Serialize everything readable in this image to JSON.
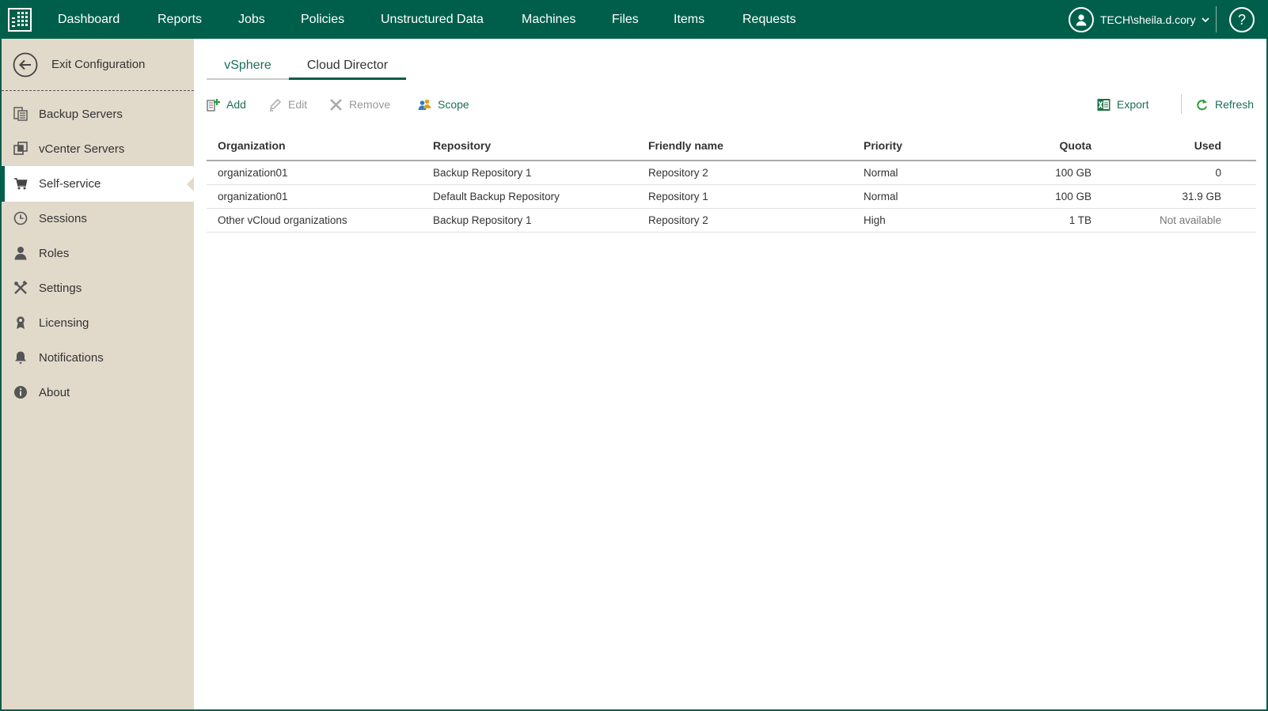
{
  "nav": {
    "items": [
      "Dashboard",
      "Reports",
      "Jobs",
      "Policies",
      "Unstructured Data",
      "Machines",
      "Files",
      "Items",
      "Requests"
    ],
    "user": "TECH\\sheila.d.cory",
    "help": "?"
  },
  "sidebar": {
    "exit_label": "Exit Configuration",
    "items": [
      {
        "label": "Backup Servers",
        "icon": "backup-servers-icon"
      },
      {
        "label": "vCenter Servers",
        "icon": "vcenter-servers-icon"
      },
      {
        "label": "Self-service",
        "icon": "cart-icon",
        "active": true
      },
      {
        "label": "Sessions",
        "icon": "clock-icon"
      },
      {
        "label": "Roles",
        "icon": "person-icon"
      },
      {
        "label": "Settings",
        "icon": "tools-icon"
      },
      {
        "label": "Licensing",
        "icon": "license-icon"
      },
      {
        "label": "Notifications",
        "icon": "bell-icon"
      },
      {
        "label": "About",
        "icon": "info-icon"
      }
    ]
  },
  "tabs": [
    {
      "label": "vSphere",
      "active": false
    },
    {
      "label": "Cloud Director",
      "active": true
    }
  ],
  "toolbar": {
    "add": "Add",
    "edit": "Edit",
    "remove": "Remove",
    "scope": "Scope",
    "export": "Export",
    "refresh": "Refresh"
  },
  "table": {
    "headers": [
      "Organization",
      "Repository",
      "Friendly name",
      "Priority",
      "Quota",
      "Used"
    ],
    "rows": [
      [
        "organization01",
        "Backup Repository 1",
        "Repository 2",
        "Normal",
        "100 GB",
        "0"
      ],
      [
        "organization01",
        "Default Backup Repository",
        "Repository 1",
        "Normal",
        "100 GB",
        "31.9 GB"
      ],
      [
        "Other vCloud organizations",
        "Backup Repository 1",
        "Repository 2",
        "High",
        "1 TB",
        "Not available"
      ]
    ]
  },
  "colors": {
    "brand": "#005f4b",
    "sidebar_bg": "#e1dacb",
    "link": "#1b6e5a"
  }
}
